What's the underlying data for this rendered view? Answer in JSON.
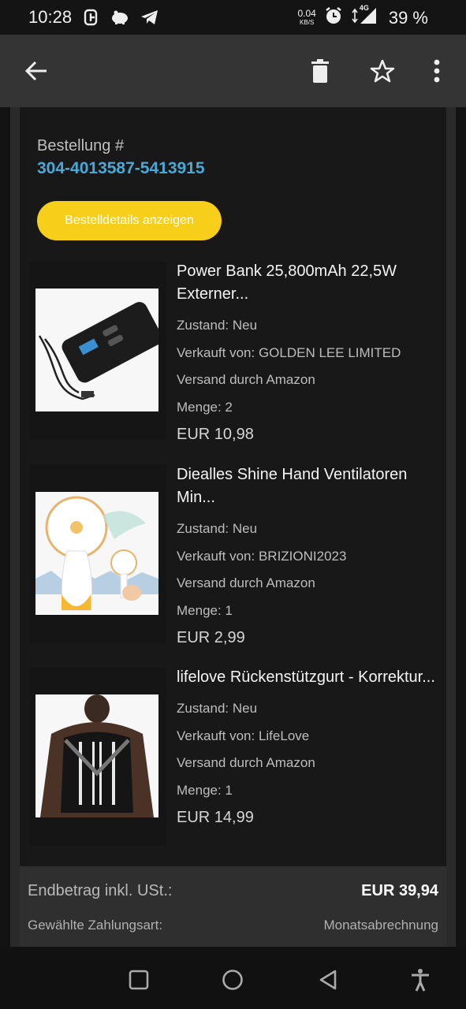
{
  "status_bar": {
    "time": "10:28",
    "net_rate": "0.04",
    "net_unit": "KB/S",
    "network": "4G",
    "battery": "39 %"
  },
  "order": {
    "label": "Bestellung #",
    "number": "304-4013587-5413915",
    "details_button": "Bestelldetails anzeigen"
  },
  "items": [
    {
      "title": "Power Bank 25,800mAh 22,5W Externer...",
      "condition": "Zustand: Neu",
      "seller": "Verkauft von: GOLDEN LEE LIMITED",
      "shipping": "Versand durch Amazon",
      "quantity": "Menge: 2",
      "price": "EUR 10,98",
      "image": "power-bank-image"
    },
    {
      "title": "Diealles Shine Hand Ventilatoren Min...",
      "condition": "Zustand: Neu",
      "seller": "Verkauft von: BRIZIONI2023",
      "shipping": "Versand durch Amazon",
      "quantity": "Menge: 1",
      "price": "EUR 2,99",
      "image": "hand-fan-image"
    },
    {
      "title": "lifelove Rückenstützgurt - Korrektur...",
      "condition": "Zustand: Neu",
      "seller": "Verkauft von: LifeLove",
      "shipping": "Versand durch Amazon",
      "quantity": "Menge: 1",
      "price": "EUR 14,99",
      "image": "back-brace-image"
    }
  ],
  "totals": {
    "label": "Endbetrag inkl. USt.:",
    "value": "EUR 39,94",
    "payment_label": "Gewählte Zahlungsart:",
    "payment_value": "Monatsabrechnung"
  },
  "colors": {
    "accent_link": "#4aa8d8",
    "button_yellow": "#f7cf1b",
    "background": "#181818"
  }
}
